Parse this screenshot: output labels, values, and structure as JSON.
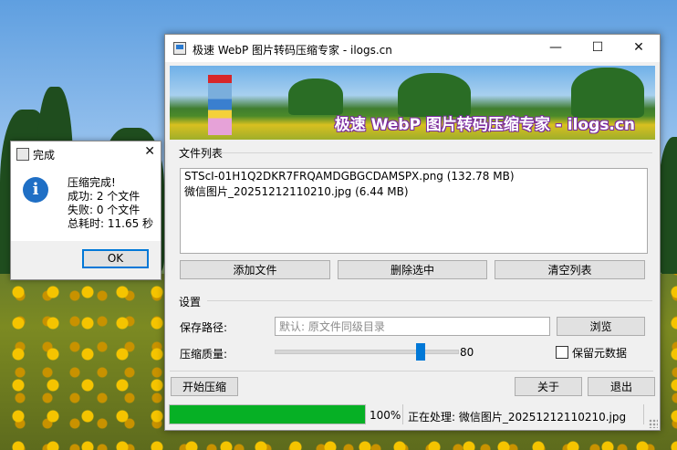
{
  "window": {
    "title": "极速 WebP 图片转码压缩专家 - ilogs.cn",
    "minimize": "—",
    "maximize": "☐",
    "close": "✕"
  },
  "banner": {
    "text": "极速 WebP 图片转码压缩专家 - ilogs.cn"
  },
  "file_list": {
    "label": "文件列表",
    "items": [
      "STScI-01H1Q2DKR7FRQAMDGBGCDAMSPX.png (132.78 MB)",
      "微信图片_20251212110210.jpg (6.44 MB)"
    ],
    "add_button": "添加文件",
    "delete_button": "删除选中",
    "clear_button": "清空列表"
  },
  "settings": {
    "label": "设置",
    "save_path_label": "保存路径:",
    "save_path_placeholder": "默认: 原文件同级目录",
    "browse_button": "浏览",
    "quality_label": "压缩质量:",
    "quality_value": 80,
    "quality_text": "80",
    "keep_metadata_label": "保留元数据"
  },
  "actions": {
    "start": "开始压缩",
    "about": "关于",
    "exit": "退出"
  },
  "status": {
    "progress_percent": 100,
    "progress_text": "100%",
    "current_text": "正在处理: 微信图片_20251212110210.jpg"
  },
  "dialog": {
    "title": "完成",
    "close": "✕",
    "icon": "info-icon",
    "icon_glyph": "i",
    "lines": [
      "压缩完成!",
      "成功: 2 个文件",
      "失败: 0 个文件",
      "总耗时: 11.65 秒"
    ],
    "ok": "OK"
  },
  "colors": {
    "accent": "#0078d7",
    "progress": "#06b025",
    "banner_text_outline": "#7a2aa0"
  }
}
